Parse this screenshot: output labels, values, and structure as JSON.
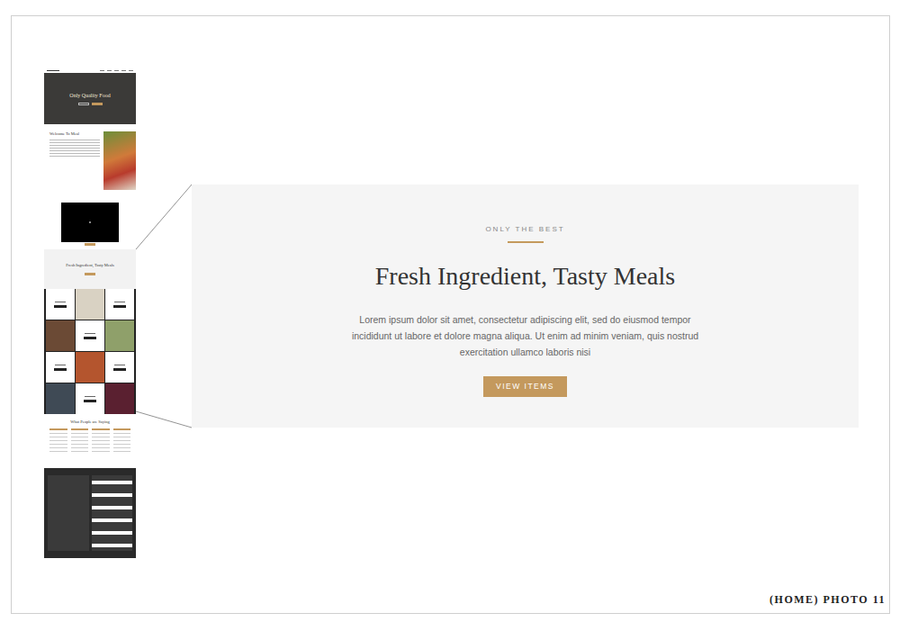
{
  "thumbnail": {
    "hero_title": "Only Quality Food",
    "welcome_title": "Welcome To Meal",
    "feature_title": "Fresh Ingredient, Tasty Meals",
    "testimonials_title": "What People are Saying"
  },
  "section": {
    "eyebrow": "ONLY THE BEST",
    "title": "Fresh Ingredient, Tasty Meals",
    "body": "Lorem ipsum dolor sit amet, consectetur adipiscing elit, sed do eiusmod tempor incididunt ut labore et dolore magna aliqua. Ut enim ad minim veniam, quis nostrud exercitation ullamco laboris nisi",
    "button": "VIEW ITEMS"
  },
  "caption": "(HOME) PHOTO 11"
}
